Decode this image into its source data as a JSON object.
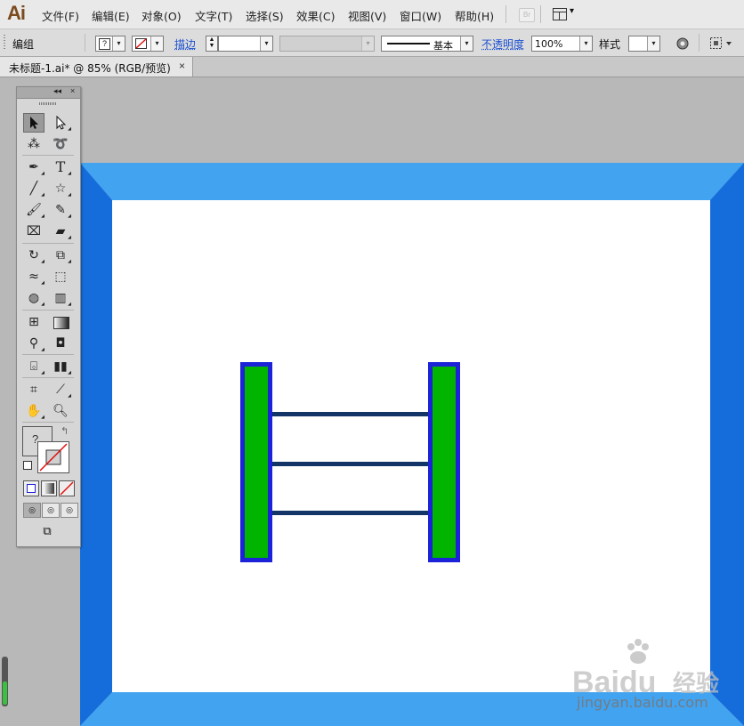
{
  "app": {
    "logo": "Ai"
  },
  "menu": {
    "items": [
      "文件(F)",
      "编辑(E)",
      "对象(O)",
      "文字(T)",
      "选择(S)",
      "效果(C)",
      "视图(V)",
      "窗口(W)",
      "帮助(H)"
    ],
    "bridge_label": "Br"
  },
  "control_bar": {
    "selection_label": "编组",
    "fill_value": "?",
    "stroke_label": "描边",
    "stroke_weight": "",
    "brush_style": "基本",
    "opacity_label": "不透明度",
    "opacity_value": "100%",
    "style_label": "样式"
  },
  "document_tab": {
    "title": "未标题-1.ai* @ 85% (RGB/预览)",
    "close": "×"
  },
  "toolbox": {
    "header_collapse": "◂◂",
    "header_close": "×",
    "fill_question": "?"
  },
  "colors": {
    "frame_light": "#42a3f0",
    "frame_dark": "#146ddb",
    "post_fill": "#00b400",
    "post_stroke": "#1c22d8",
    "rung": "#123466"
  },
  "watermark": {
    "brand": "Baidu",
    "jingyan": "经验",
    "url": "jingyan.baidu.com"
  }
}
